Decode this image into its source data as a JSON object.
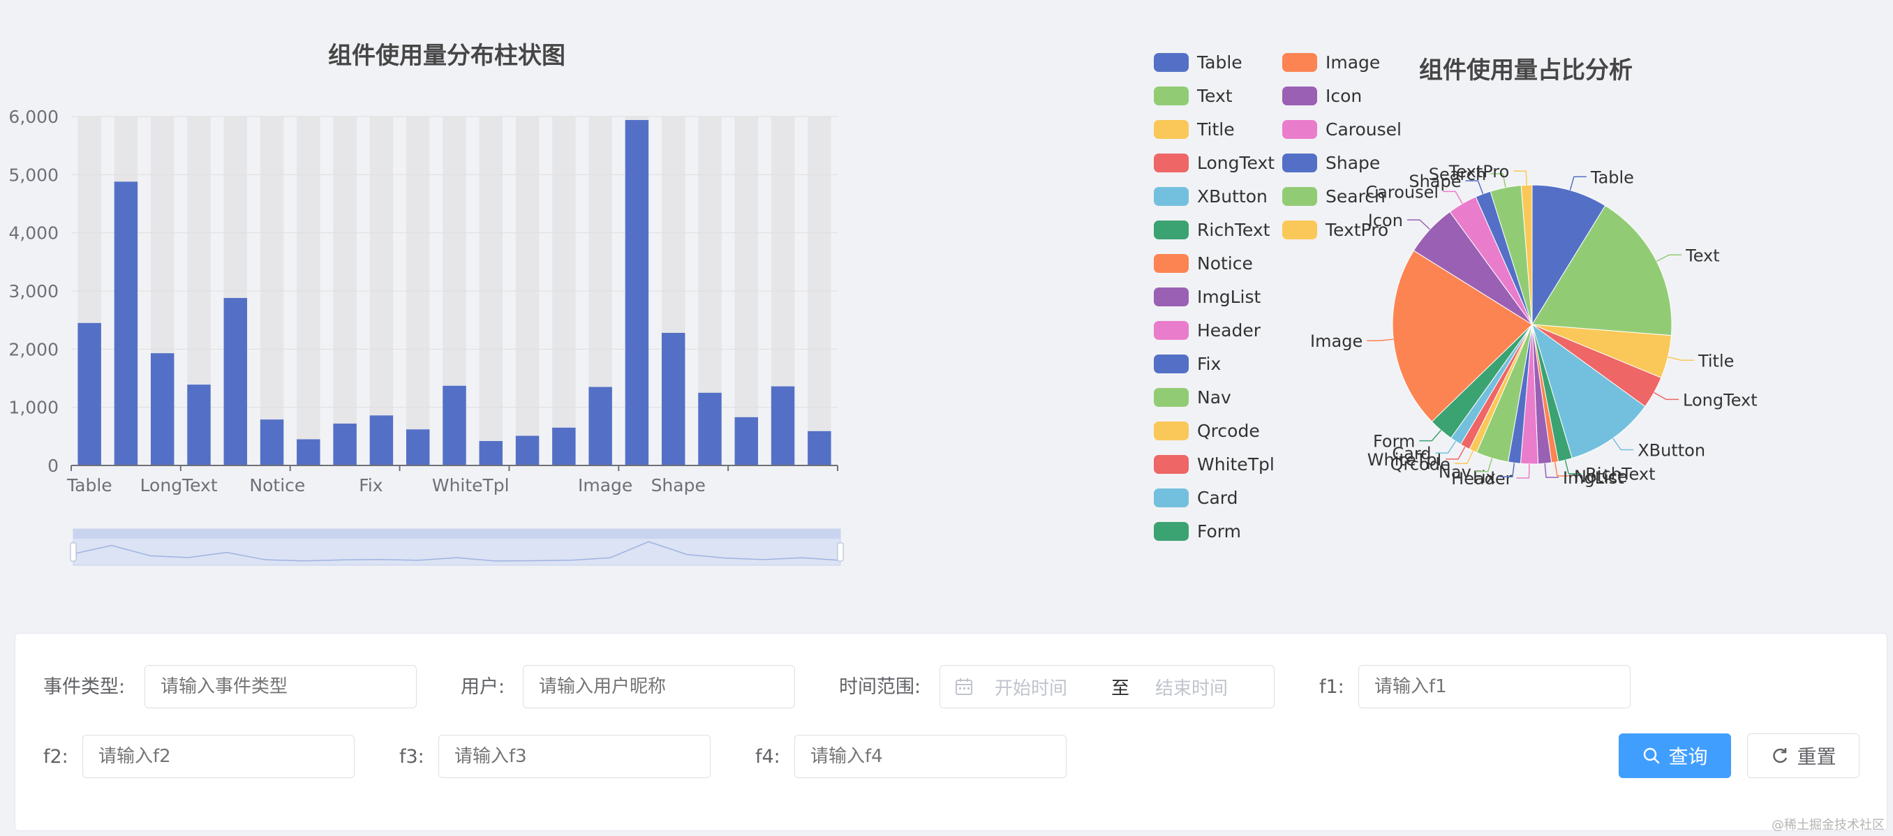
{
  "bar_chart": {
    "title": "组件使用量分布柱状图"
  },
  "pie_chart": {
    "title": "组件使用量占比分析"
  },
  "colors": {
    "palette": [
      "#5470c6",
      "#91cc75",
      "#fac858",
      "#ee6666",
      "#73c0de",
      "#3ba272",
      "#fc8452",
      "#9a60b4",
      "#ea7ccc"
    ],
    "bar": "#5470c6",
    "bar_shadow": "#e6e6e8",
    "primary_button": "#409eff"
  },
  "chart_data": [
    {
      "type": "bar",
      "title": "组件使用量分布柱状图",
      "categories": [
        "Table",
        "Text",
        "LongText",
        "Title",
        "XButton",
        "Notice",
        "RichText",
        "ImgList",
        "Fix",
        "Header",
        "WhiteTpl",
        "Nav",
        "Qrcode",
        "Card",
        "Image",
        "Form",
        "Shape",
        "Icon",
        "Carousel",
        "Search",
        "TextPro"
      ],
      "tick_labels": [
        "Table",
        "LongText",
        "Notice",
        "Fix",
        "WhiteTpl",
        "Image",
        "Shape"
      ],
      "values": [
        2450,
        4880,
        1930,
        1390,
        2880,
        790,
        450,
        720,
        860,
        620,
        1370,
        420,
        510,
        650,
        1350,
        5940,
        2280,
        1250,
        830,
        1360,
        590
      ],
      "y_ticks": [
        "0",
        "1,000",
        "2,000",
        "3,000",
        "4,000",
        "5,000",
        "6,000"
      ],
      "ylim": [
        0,
        6000
      ],
      "grid": true,
      "data_zoom": true
    },
    {
      "type": "pie",
      "title": "组件使用量占比分析",
      "legend_position": "left",
      "slices": [
        {
          "name": "Table",
          "value": 2450
        },
        {
          "name": "Text",
          "value": 4880
        },
        {
          "name": "Title",
          "value": 1390
        },
        {
          "name": "LongText",
          "value": 1050
        },
        {
          "name": "XButton",
          "value": 2900
        },
        {
          "name": "RichText",
          "value": 450
        },
        {
          "name": "Notice",
          "value": 220
        },
        {
          "name": "ImgList",
          "value": 430
        },
        {
          "name": "Header",
          "value": 560
        },
        {
          "name": "Fix",
          "value": 400
        },
        {
          "name": "Nav",
          "value": 1050
        },
        {
          "name": "Qrcode",
          "value": 250
        },
        {
          "name": "WhiteTpl",
          "value": 320
        },
        {
          "name": "Card",
          "value": 370
        },
        {
          "name": "Form",
          "value": 800
        },
        {
          "name": "Image",
          "value": 5900
        },
        {
          "name": "Icon",
          "value": 1700
        },
        {
          "name": "Carousel",
          "value": 950
        },
        {
          "name": "Shape",
          "value": 500
        },
        {
          "name": "Search",
          "value": 1000
        },
        {
          "name": "TextPro",
          "value": 350
        }
      ]
    }
  ],
  "filters": {
    "event_type": {
      "label": "事件类型:",
      "placeholder": "请输入事件类型"
    },
    "user": {
      "label": "用户:",
      "placeholder": "请输入用户昵称"
    },
    "time_range": {
      "label": "时间范围:",
      "start": "开始时间",
      "separator": "至",
      "end": "结束时间"
    },
    "f1": {
      "label": "f1:",
      "placeholder": "请输入f1"
    },
    "f2": {
      "label": "f2:",
      "placeholder": "请输入f2"
    },
    "f3": {
      "label": "f3:",
      "placeholder": "请输入f3"
    },
    "f4": {
      "label": "f4:",
      "placeholder": "请输入f4"
    }
  },
  "buttons": {
    "query": "查询",
    "reset": "重置"
  },
  "watermark": "@稀土掘金技术社区"
}
